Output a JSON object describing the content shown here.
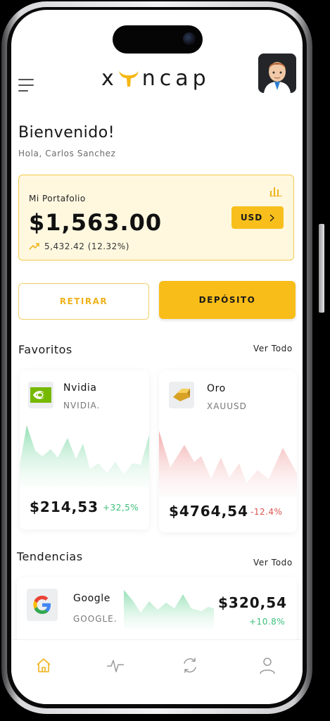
{
  "app": {
    "logo_left": "x",
    "logo_right": "ncap"
  },
  "header": {
    "welcome": "Bienvenido!",
    "greeting": "Hola, Carlos Sanchez"
  },
  "portfolio": {
    "label": "Mi Portafolio",
    "value": "$1,563.00",
    "change": "5,432.42 (12.32%)",
    "currency_button": "USD"
  },
  "actions": {
    "withdraw": "RETIRAR",
    "deposit": "DEPÓSITO"
  },
  "favorites": {
    "title": "Favoritos",
    "see_all": "Ver Todo",
    "items": [
      {
        "name": "Nvidia",
        "ticker": "NVIDIA.",
        "price": "$214,53",
        "change": "+32,5%",
        "icon": "nvidia-logo-icon"
      },
      {
        "name": "Oro",
        "ticker": "XAUUSD",
        "price": "$4764,54",
        "change": "-12.4%",
        "icon": "gold-bar-icon"
      }
    ]
  },
  "trends": {
    "title": "Tendencias",
    "see_all": "Ver Todo",
    "items": [
      {
        "name": "Google",
        "ticker": "GOOGLE.",
        "price": "$320,54",
        "change": "+10.8%",
        "icon": "google-logo-icon"
      }
    ]
  },
  "tabbar": {
    "items": [
      "home-icon",
      "activity-icon",
      "exchange-icon",
      "profile-icon"
    ],
    "active": "home-icon"
  },
  "colors": {
    "accent": "#f8bd18",
    "positive": "#3cbf7a",
    "negative": "#d9534f",
    "portfolio_bg": "#fff8df"
  }
}
